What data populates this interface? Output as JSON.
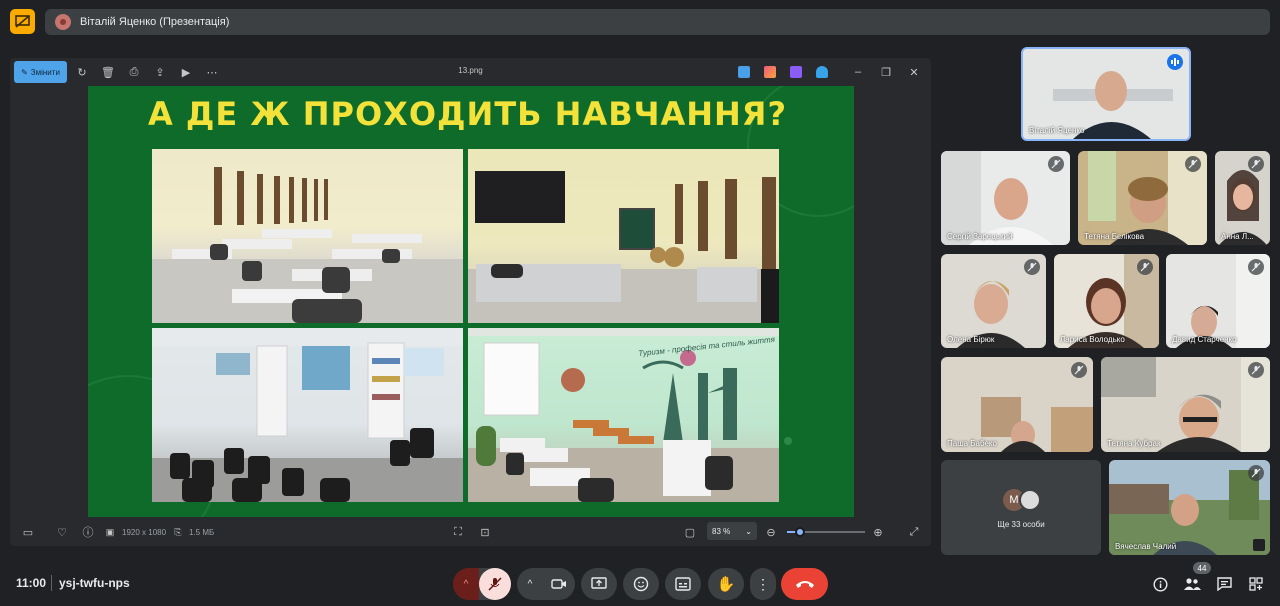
{
  "meeting": {
    "presenter_title": "Віталій Яценко (Презентація)",
    "time": "11:00",
    "code": "ysj-twfu-nps",
    "participants_count": "44"
  },
  "viewer": {
    "edit_label": "Змінити",
    "file_name": "13.png",
    "dimensions": "1920 x 1080",
    "file_size": "1.5 МБ",
    "zoom": "83 %",
    "zoom_level": 0.1
  },
  "slide": {
    "title": "А ДЕ Ж ПРОХОДИТЬ НАВЧАННЯ?",
    "wall_text": "Туризм - професія та стиль життя"
  },
  "participants": {
    "main": "Віталій Яценко",
    "tiles": [
      "Сергій Зарецький",
      "Тетяна Бєлікова",
      "Анна Л...",
      "Олена Бірюк",
      "Лариса Володько",
      "Давид Старченко",
      "Паша Бабеко",
      "Тетяна Кубрак",
      "Вячеслав Чалий"
    ],
    "more_label": "Ще 33 особи",
    "more_initial": "M"
  },
  "colors": {
    "slide_bg": "#0f6b2a",
    "slide_title": "#f2e23a",
    "end_call": "#ea4335",
    "mic_muted_bg": "#f9dedc",
    "accent": "#8ab4f8"
  }
}
